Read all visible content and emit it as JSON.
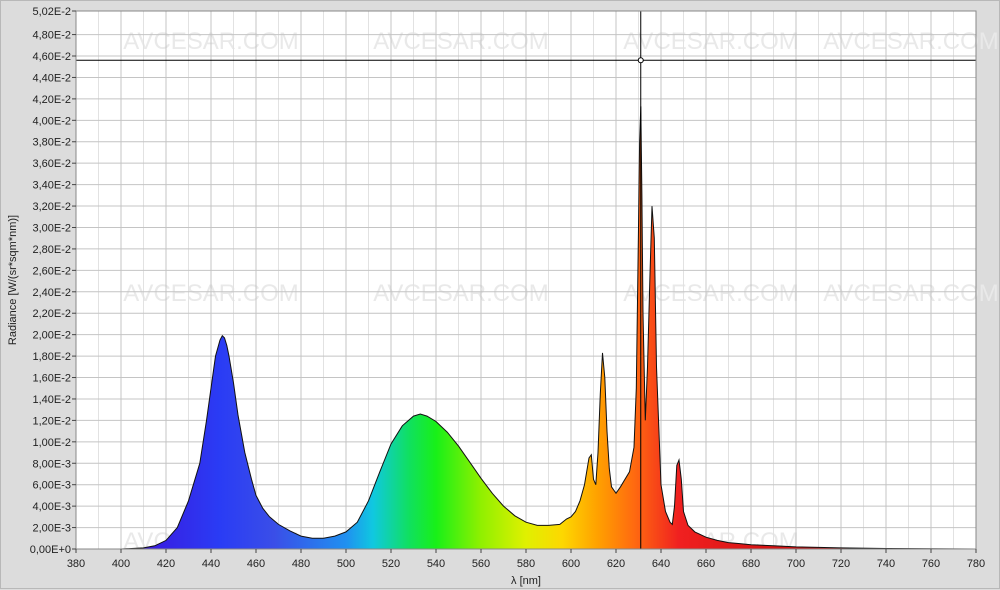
{
  "chart_data": {
    "type": "area",
    "xlabel": "λ [nm]",
    "ylabel": "Radiance [W/(sr*sqm*nm)]",
    "xlim": [
      380,
      780
    ],
    "ylim": [
      0,
      0.0502
    ],
    "x_ticks": [
      380,
      400,
      420,
      440,
      460,
      480,
      500,
      520,
      540,
      560,
      580,
      600,
      620,
      640,
      660,
      680,
      700,
      720,
      740,
      760,
      780
    ],
    "y_ticks": [
      0,
      0.002,
      0.004,
      0.006,
      0.008,
      0.01,
      0.012,
      0.014,
      0.016,
      0.018,
      0.02,
      0.022,
      0.024,
      0.026,
      0.028,
      0.03,
      0.032,
      0.034,
      0.036,
      0.038,
      0.04,
      0.042,
      0.044,
      0.046,
      0.048,
      0.0502
    ],
    "y_tick_labels": [
      "0,00E+0",
      "2,00E-3",
      "4,00E-3",
      "6,00E-3",
      "8,00E-3",
      "1,00E-2",
      "1,20E-2",
      "1,40E-2",
      "1,60E-2",
      "1,80E-2",
      "2,00E-2",
      "2,20E-2",
      "2,40E-2",
      "2,60E-2",
      "2,80E-2",
      "3,00E-2",
      "3,20E-2",
      "3,40E-2",
      "3,60E-2",
      "3,80E-2",
      "4,00E-2",
      "4,20E-2",
      "4,40E-2",
      "4,60E-2",
      "4,80E-2",
      "5,02E-2"
    ],
    "cursor": {
      "x": 631,
      "y": 0.0456
    },
    "watermark": "AVCESAR.COM",
    "grid": true,
    "series": [
      {
        "x": [
          380,
          400,
          410,
          415,
          420,
          425,
          430,
          435,
          438,
          440,
          442,
          444,
          445,
          446,
          447,
          448,
          450,
          452,
          455,
          458,
          460,
          463,
          466,
          470,
          475,
          480,
          485,
          490,
          495,
          500,
          505,
          510,
          515,
          520,
          525,
          530,
          533,
          536,
          540,
          545,
          550,
          555,
          560,
          565,
          570,
          575,
          580,
          585,
          590,
          595,
          598,
          600,
          602,
          604,
          606,
          608,
          609,
          610,
          611,
          612,
          613,
          614,
          615,
          616,
          617,
          618,
          619,
          620,
          622,
          624,
          626,
          628,
          629,
          630,
          630.5,
          631,
          631.5,
          632,
          633,
          634,
          635,
          636,
          637,
          638,
          640,
          642,
          644,
          645,
          646,
          647,
          648,
          649,
          650,
          652,
          655,
          660,
          665,
          670,
          675,
          680,
          690,
          700,
          720,
          740,
          760,
          780
        ],
        "y": [
          0,
          0,
          0.0001,
          0.0003,
          0.0008,
          0.002,
          0.0045,
          0.008,
          0.012,
          0.015,
          0.018,
          0.0195,
          0.0199,
          0.0197,
          0.019,
          0.018,
          0.0155,
          0.0125,
          0.009,
          0.0065,
          0.005,
          0.0038,
          0.003,
          0.0023,
          0.0017,
          0.0012,
          0.001,
          0.001,
          0.0012,
          0.0016,
          0.0025,
          0.0045,
          0.0072,
          0.0098,
          0.0115,
          0.0124,
          0.0126,
          0.0124,
          0.0119,
          0.0109,
          0.0096,
          0.0081,
          0.0066,
          0.0052,
          0.004,
          0.0031,
          0.0025,
          0.0022,
          0.0022,
          0.0023,
          0.0028,
          0.003,
          0.0035,
          0.0045,
          0.006,
          0.0085,
          0.0088,
          0.0065,
          0.006,
          0.009,
          0.0145,
          0.0183,
          0.016,
          0.011,
          0.0075,
          0.0058,
          0.0055,
          0.0052,
          0.0058,
          0.0065,
          0.0072,
          0.0095,
          0.015,
          0.03,
          0.038,
          0.0413,
          0.033,
          0.022,
          0.012,
          0.017,
          0.025,
          0.032,
          0.029,
          0.017,
          0.006,
          0.0035,
          0.0025,
          0.0023,
          0.004,
          0.0078,
          0.0083,
          0.0065,
          0.0035,
          0.0022,
          0.0016,
          0.0011,
          0.0008,
          0.0006,
          0.0005,
          0.0004,
          0.0003,
          0.0002,
          0.0001,
          5e-05,
          2e-05,
          0
        ]
      }
    ]
  }
}
